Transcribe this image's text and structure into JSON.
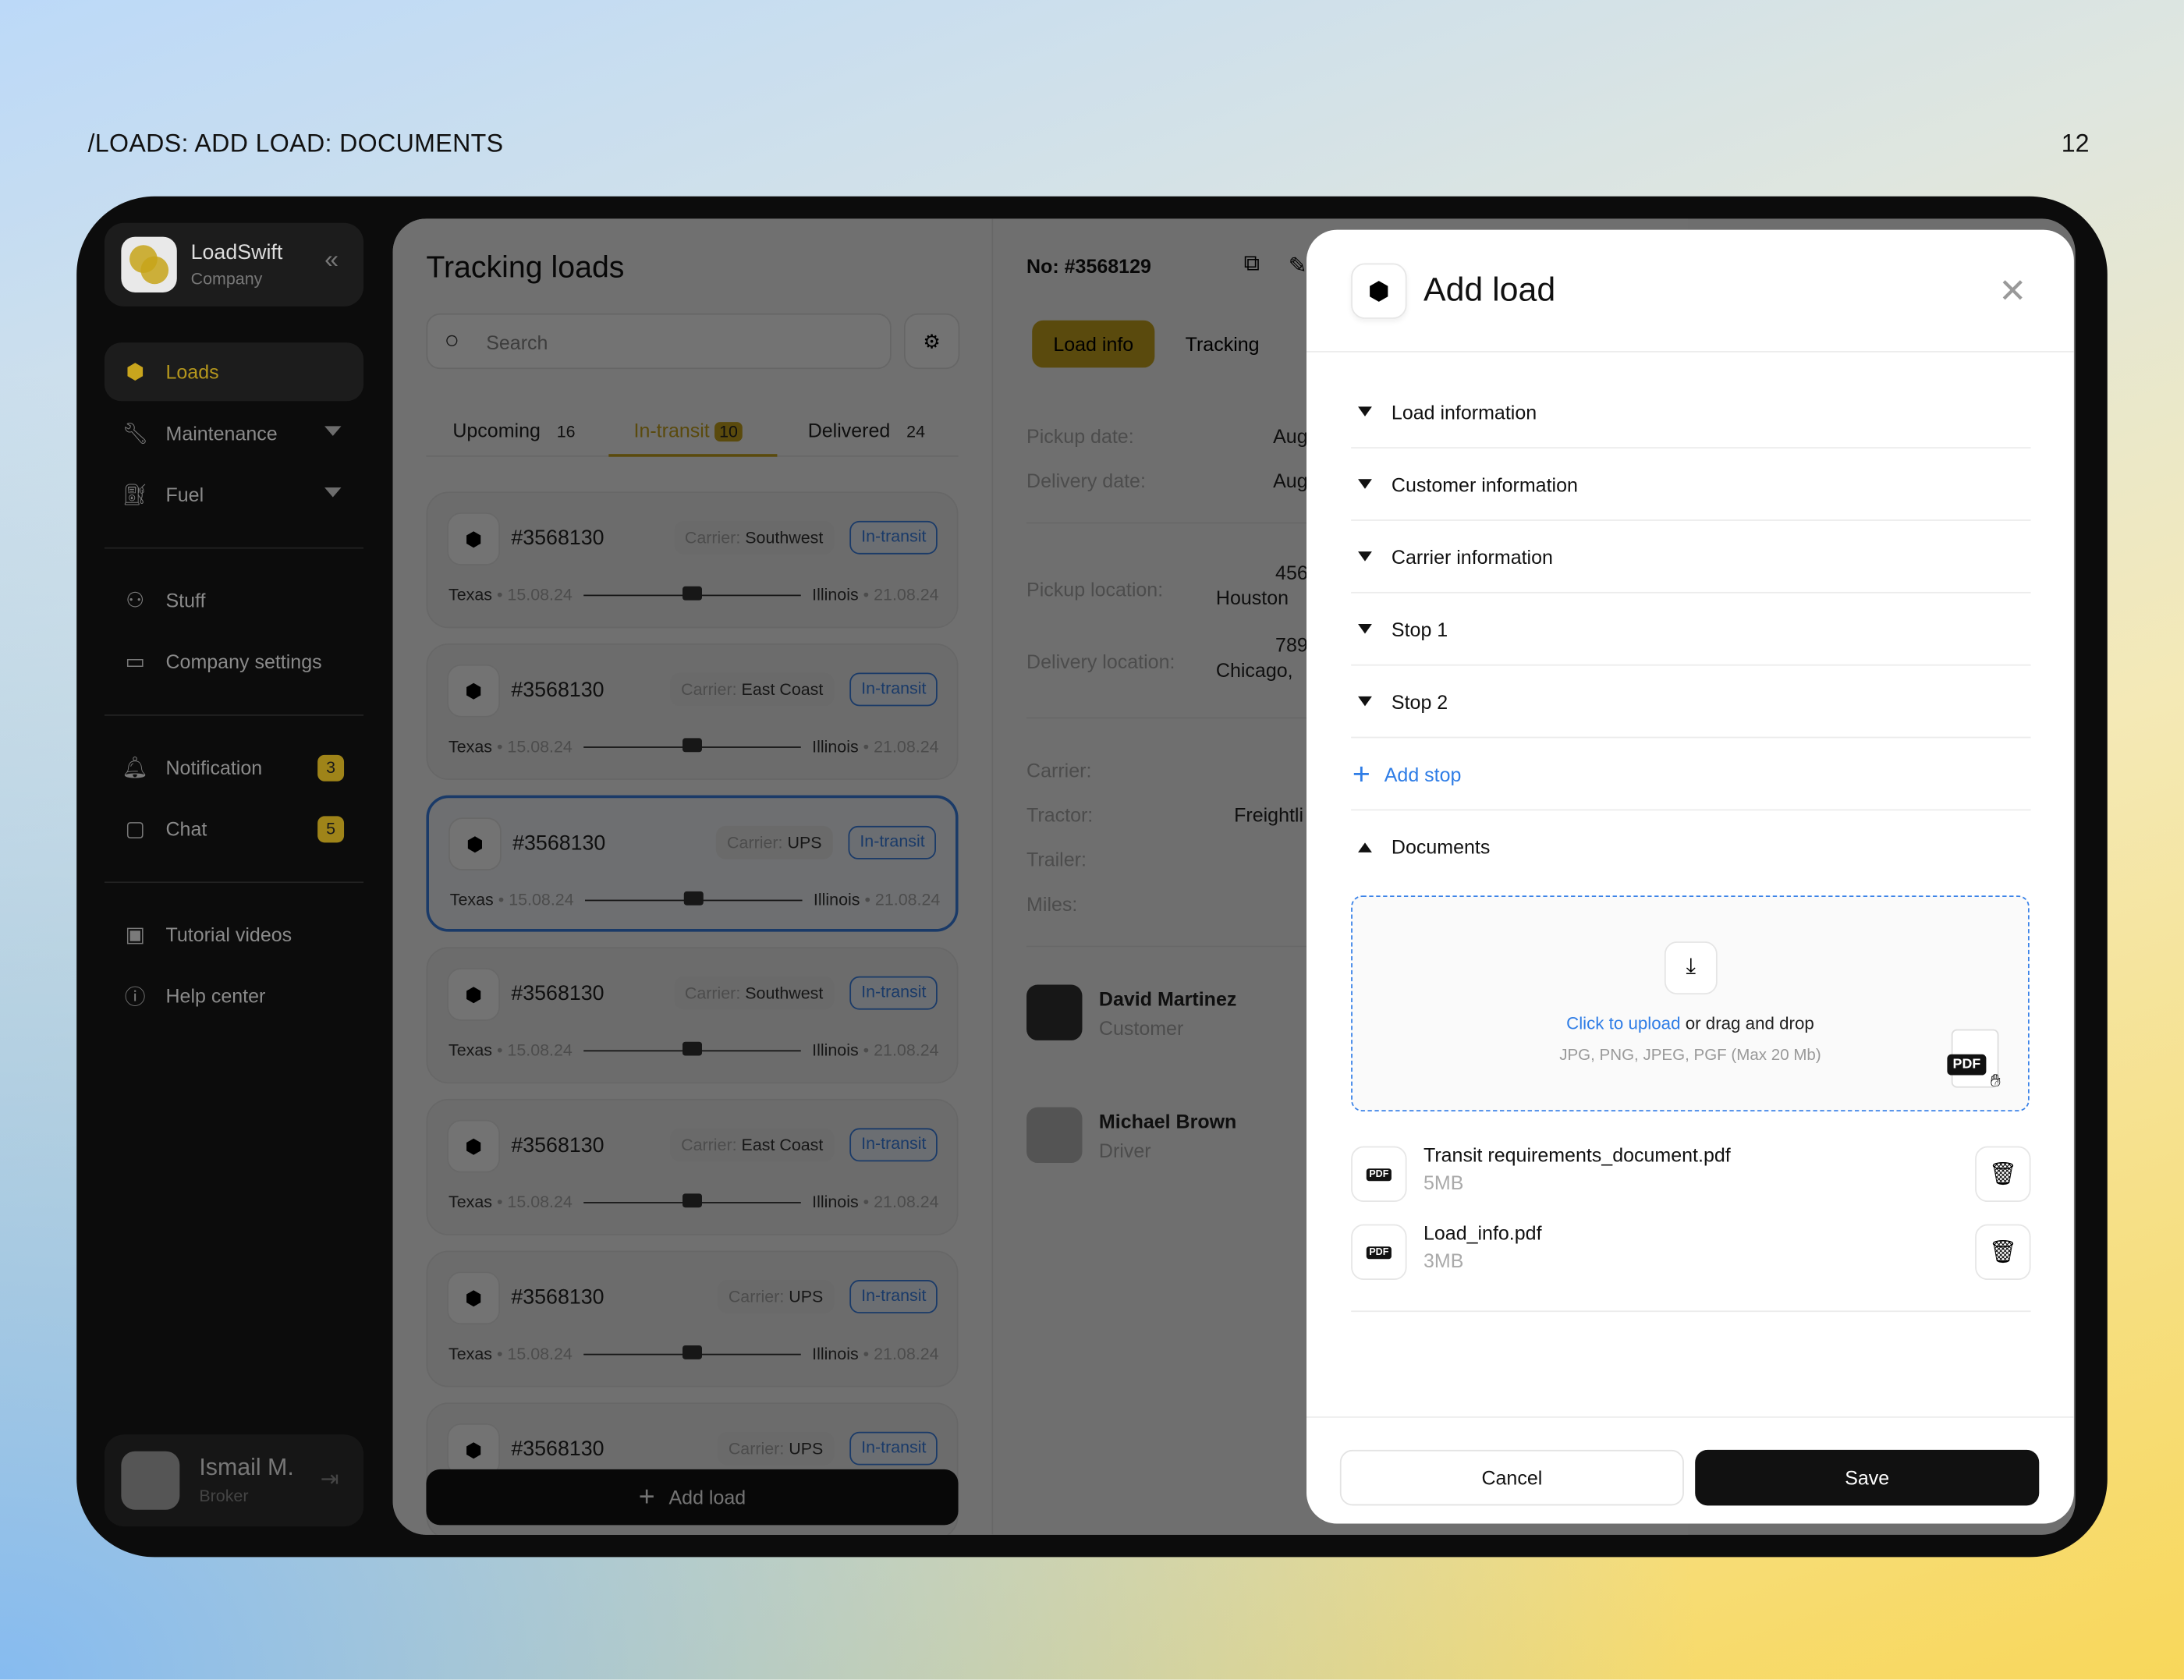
{
  "page": {
    "breadcrumb": "/LOADS: ADD LOAD: DOCUMENTS",
    "page_number": "12"
  },
  "colors": {
    "accent": "#c9a51d",
    "link": "#2f7de6",
    "in_transit": "#3a82e8"
  },
  "sidebar": {
    "brand": {
      "name": "LoadSwift",
      "subtitle": "Company"
    },
    "items": [
      {
        "label": "Loads",
        "icon": "box-icon",
        "active": true
      },
      {
        "label": "Maintenance",
        "icon": "wrench-icon",
        "dropdown": true
      },
      {
        "label": "Fuel",
        "icon": "fuel-icon",
        "dropdown": true
      },
      {
        "label": "Stuff",
        "icon": "users-icon"
      },
      {
        "label": "Company settings",
        "icon": "briefcase-icon"
      },
      {
        "label": "Notification",
        "icon": "bell-icon",
        "badge": "3"
      },
      {
        "label": "Chat",
        "icon": "chat-icon",
        "badge": "5"
      },
      {
        "label": "Tutorial videos",
        "icon": "video-icon"
      },
      {
        "label": "Help center",
        "icon": "help-icon"
      }
    ],
    "user": {
      "name": "Ismail M.",
      "role": "Broker"
    }
  },
  "tracking": {
    "title": "Tracking loads",
    "search_placeholder": "Search",
    "tabs": [
      {
        "label": "Upcoming",
        "count": "16"
      },
      {
        "label": "In-transit",
        "count": "10",
        "active": true
      },
      {
        "label": "Delivered",
        "count": "24"
      }
    ],
    "cards": [
      {
        "id": "#3568130",
        "carrier_label": "Carrier:",
        "carrier": "Southwest",
        "status": "In-transit",
        "from": "Texas",
        "from_date": "15.08.24",
        "to": "Illinois",
        "to_date": "21.08.24"
      },
      {
        "id": "#3568130",
        "carrier_label": "Carrier:",
        "carrier": "East Coast",
        "status": "In-transit",
        "from": "Texas",
        "from_date": "15.08.24",
        "to": "Illinois",
        "to_date": "21.08.24"
      },
      {
        "id": "#3568130",
        "carrier_label": "Carrier:",
        "carrier": "UPS",
        "status": "In-transit",
        "from": "Texas",
        "from_date": "15.08.24",
        "to": "Illinois",
        "to_date": "21.08.24",
        "selected": true
      },
      {
        "id": "#3568130",
        "carrier_label": "Carrier:",
        "carrier": "Southwest",
        "status": "In-transit",
        "from": "Texas",
        "from_date": "15.08.24",
        "to": "Illinois",
        "to_date": "21.08.24"
      },
      {
        "id": "#3568130",
        "carrier_label": "Carrier:",
        "carrier": "East Coast",
        "status": "In-transit",
        "from": "Texas",
        "from_date": "15.08.24",
        "to": "Illinois",
        "to_date": "21.08.24"
      },
      {
        "id": "#3568130",
        "carrier_label": "Carrier:",
        "carrier": "UPS",
        "status": "In-transit",
        "from": "Texas",
        "from_date": "15.08.24",
        "to": "Illinois",
        "to_date": "21.08.24"
      },
      {
        "id": "#3568130",
        "carrier_label": "Carrier:",
        "carrier": "UPS",
        "status": "In-transit"
      }
    ],
    "add_button": "Add load"
  },
  "detail": {
    "number": "No: #3568129",
    "tabs": [
      "Load info",
      "Tracking"
    ],
    "fields": [
      {
        "label": "Pickup date:",
        "value": "Aug"
      },
      {
        "label": "Delivery date:",
        "value": "Aug"
      },
      {
        "label": "Pickup location:",
        "value": "456",
        "value2": "Houston"
      },
      {
        "label": "Delivery location:",
        "value": "789",
        "value2": "Chicago,"
      },
      {
        "label": "Carrier:",
        "value": ""
      },
      {
        "label": "Tractor:",
        "value": "Freightli"
      },
      {
        "label": "Trailer:",
        "value": ""
      },
      {
        "label": "Miles:",
        "value": ""
      }
    ],
    "people": [
      {
        "name": "David Martinez",
        "role": "Customer"
      },
      {
        "name": "Michael Brown",
        "role": "Driver"
      }
    ]
  },
  "modal": {
    "title": "Add load",
    "sections": [
      "Load information",
      "Customer information",
      "Carrier information",
      "Stop 1",
      "Stop 2"
    ],
    "add_stop": "Add stop",
    "documents": "Documents",
    "upload": {
      "link": "Click to upload",
      "text": " or drag and drop",
      "hint": "JPG, PNG, JPEG, PGF (Max 20 Mb)",
      "drag_tag": "PDF"
    },
    "files": [
      {
        "name": "Transit requirements_document.pdf",
        "size": "5MB",
        "tag": "PDF"
      },
      {
        "name": "Load_info.pdf",
        "size": "3MB",
        "tag": "PDF"
      }
    ],
    "cancel": "Cancel",
    "save": "Save"
  }
}
